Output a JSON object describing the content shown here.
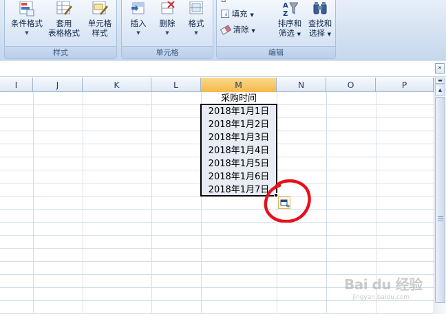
{
  "ribbon": {
    "styles_group": {
      "label": "样式",
      "buttons": [
        {
          "label": "条件格式",
          "icon": "conditional-format-icon"
        },
        {
          "label": "套用\n表格格式",
          "line1": "套用",
          "line2": "表格格式",
          "icon": "format-as-table-icon"
        },
        {
          "label": "单元格\n样式",
          "line1": "单元格",
          "line2": "样式",
          "icon": "cell-styles-icon"
        }
      ]
    },
    "cells_group": {
      "label": "单元格",
      "buttons": [
        {
          "label": "插入",
          "icon": "insert-icon"
        },
        {
          "label": "删除",
          "icon": "delete-icon"
        },
        {
          "label": "格式",
          "icon": "format-icon"
        }
      ]
    },
    "edit_group": {
      "label": "编辑",
      "fill_label": "填充",
      "clear_label": "清除",
      "sort_line1": "排序和",
      "sort_line2": "筛选",
      "find_line1": "查找和",
      "find_line2": "选择"
    }
  },
  "columns": [
    "I",
    "J",
    "K",
    "L",
    "M",
    "N",
    "O",
    "P"
  ],
  "selected_column": "M",
  "sheet": {
    "header_cell": "采购时间",
    "dates": [
      "2018年1月1日",
      "2018年1月2日",
      "2018年1月3日",
      "2018年1月4日",
      "2018年1月5日",
      "2018年1月6日",
      "2018年1月7日"
    ]
  },
  "watermark": {
    "main": "Bai du 经验",
    "sub": "jingyan.baidu.com"
  },
  "colors": {
    "selection_header": "#f5b94a",
    "annotation": "#e8101a",
    "ribbon": "#d3e0f1"
  }
}
